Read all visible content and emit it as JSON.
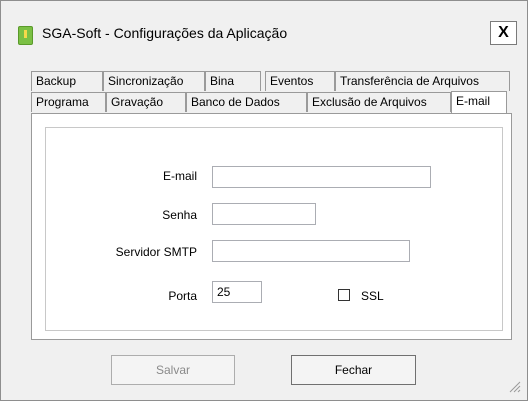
{
  "window": {
    "title": "SGA-Soft - Configurações da Aplicação",
    "close_label": "X"
  },
  "tabs_row1": [
    "Backup",
    "Sincronização",
    "Bina",
    "Eventos",
    "Transferência de Arquivos"
  ],
  "tabs_row2": [
    "Programa",
    "Gravação",
    "Banco de Dados",
    "Exclusão de Arquivos",
    "E-mail"
  ],
  "active_tab": "E-mail",
  "form": {
    "email_label": "E-mail",
    "email_value": "",
    "senha_label": "Senha",
    "senha_value": "",
    "smtp_label": "Servidor SMTP",
    "smtp_value": "",
    "porta_label": "Porta",
    "porta_value": "25",
    "ssl_label": "SSL",
    "ssl_checked": false
  },
  "buttons": {
    "save_label": "Salvar",
    "close_label": "Fechar"
  }
}
